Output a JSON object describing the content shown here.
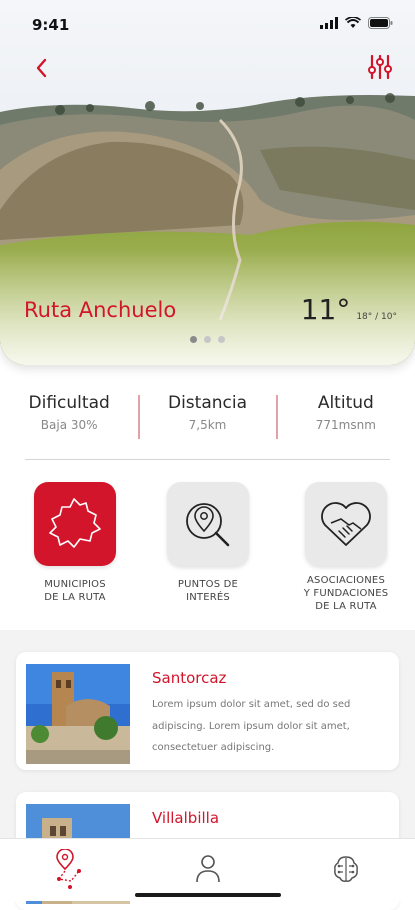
{
  "status_bar": {
    "time": "9:41"
  },
  "hero": {
    "title": "Ruta Anchuelo",
    "temperature": "11°",
    "temp_range": "18° / 10°",
    "carousel": {
      "total": 3,
      "active": 0
    }
  },
  "stats": [
    {
      "label": "Dificultad",
      "value": "Baja 30%"
    },
    {
      "label": "Distancia",
      "value": "7,5km"
    },
    {
      "label": "Altitud",
      "value": "771msnm"
    }
  ],
  "categories": [
    {
      "label_line1": "MUNICIPIOS",
      "label_line2": "DE LA RUTA",
      "label_line3": "",
      "icon": "map-region-icon",
      "active": true
    },
    {
      "label_line1": "PUNTOS DE",
      "label_line2": "INTERÉS",
      "label_line3": "",
      "icon": "location-search-icon",
      "active": false
    },
    {
      "label_line1": "ASOCIACIONES",
      "label_line2": "Y FUNDACIONES",
      "label_line3": "DE LA RUTA",
      "icon": "heart-handshake-icon",
      "active": false
    }
  ],
  "places": [
    {
      "title": "Santorcaz",
      "description": "Lorem ipsum dolor sit amet, sed do sed adipiscing. Lorem ipsum dolor sit amet, consectetuer adipiscing."
    },
    {
      "title": "Villalbilla",
      "description": ""
    }
  ],
  "bottom_nav": [
    {
      "icon": "route-pin-icon",
      "active": true
    },
    {
      "icon": "user-icon",
      "active": false
    },
    {
      "icon": "brain-circuit-icon",
      "active": false
    }
  ],
  "colors": {
    "accent": "#d2152a",
    "muted": "#888888"
  }
}
